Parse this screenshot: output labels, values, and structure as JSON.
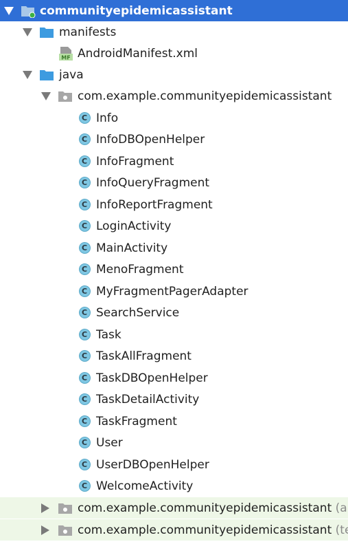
{
  "tree": {
    "module": {
      "label": "communityepidemicassistant"
    },
    "manifests": {
      "label": "manifests",
      "file": {
        "label": "AndroidManifest.xml",
        "badge": "MF"
      }
    },
    "java": {
      "label": "java"
    },
    "main_package": {
      "label": "com.example.communityepidemicassistant",
      "classes": [
        "Info",
        "InfoDBOpenHelper",
        "InfoFragment",
        "InfoQueryFragment",
        "InfoReportFragment",
        "LoginActivity",
        "MainActivity",
        "MenoFragment",
        "MyFragmentPagerAdapter",
        "SearchService",
        "Task",
        "TaskAllFragment",
        "TaskDBOpenHelper",
        "TaskDetailActivity",
        "TaskFragment",
        "User",
        "UserDBOpenHelper",
        "WelcomeActivity"
      ],
      "class_icon_letter": "C"
    },
    "test_packages": [
      {
        "label": "com.example.communityepidemicassistant",
        "suffix": "(ar"
      },
      {
        "label": "com.example.communityepidemicassistant",
        "suffix": "(te"
      }
    ]
  },
  "colors": {
    "selection": "#2f6fd6",
    "test_background": "#eef7e7",
    "folder": "#3d9be0",
    "class_icon": "#7fc7e3"
  },
  "icons": [
    "expanded-arrow-icon",
    "collapsed-arrow-icon",
    "module-folder-icon",
    "folder-icon",
    "manifest-file-icon",
    "package-icon",
    "class-icon"
  ]
}
